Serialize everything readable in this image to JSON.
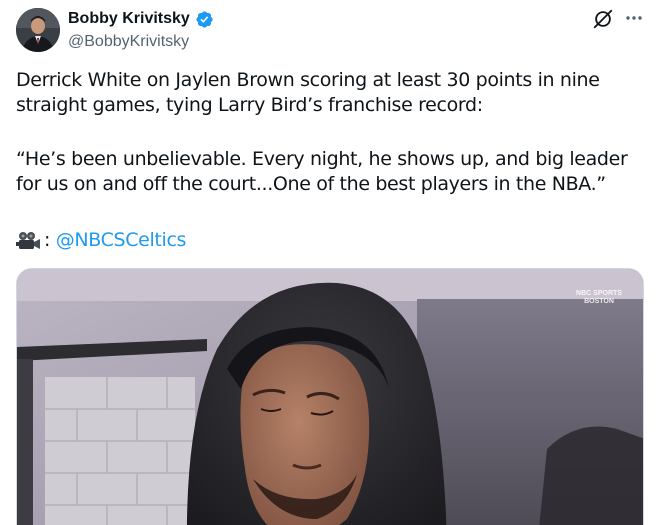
{
  "author": {
    "display_name": "Bobby Krivitsky",
    "handle": "@BobbyKrivitsky",
    "verified_icon": "verified-badge-icon",
    "avatar_icon": "profile-photo"
  },
  "header_actions": {
    "grok_icon": "grok-icon",
    "more_icon": "more-options-icon"
  },
  "tweet": {
    "paragraph1": "Derrick White on Jaylen Brown scoring at least 30 points in nine straight games, tying Larry Bird’s franchise record:",
    "paragraph2": "“He’s been unbelievable. Every night, he shows up, and big leader for us on and off the court...One of the best players in the NBA.”",
    "credit_separator": ": ",
    "mention": "@NBCSCeltics",
    "credit_icon": "movie-camera-icon"
  },
  "media": {
    "watermark_line1": "NBC SPORTS",
    "watermark_line2": "BOSTON",
    "description_icon": "video-thumbnail"
  },
  "colors": {
    "accent": "#1d9bf0",
    "text": "#0f1419",
    "secondary": "#536471"
  }
}
